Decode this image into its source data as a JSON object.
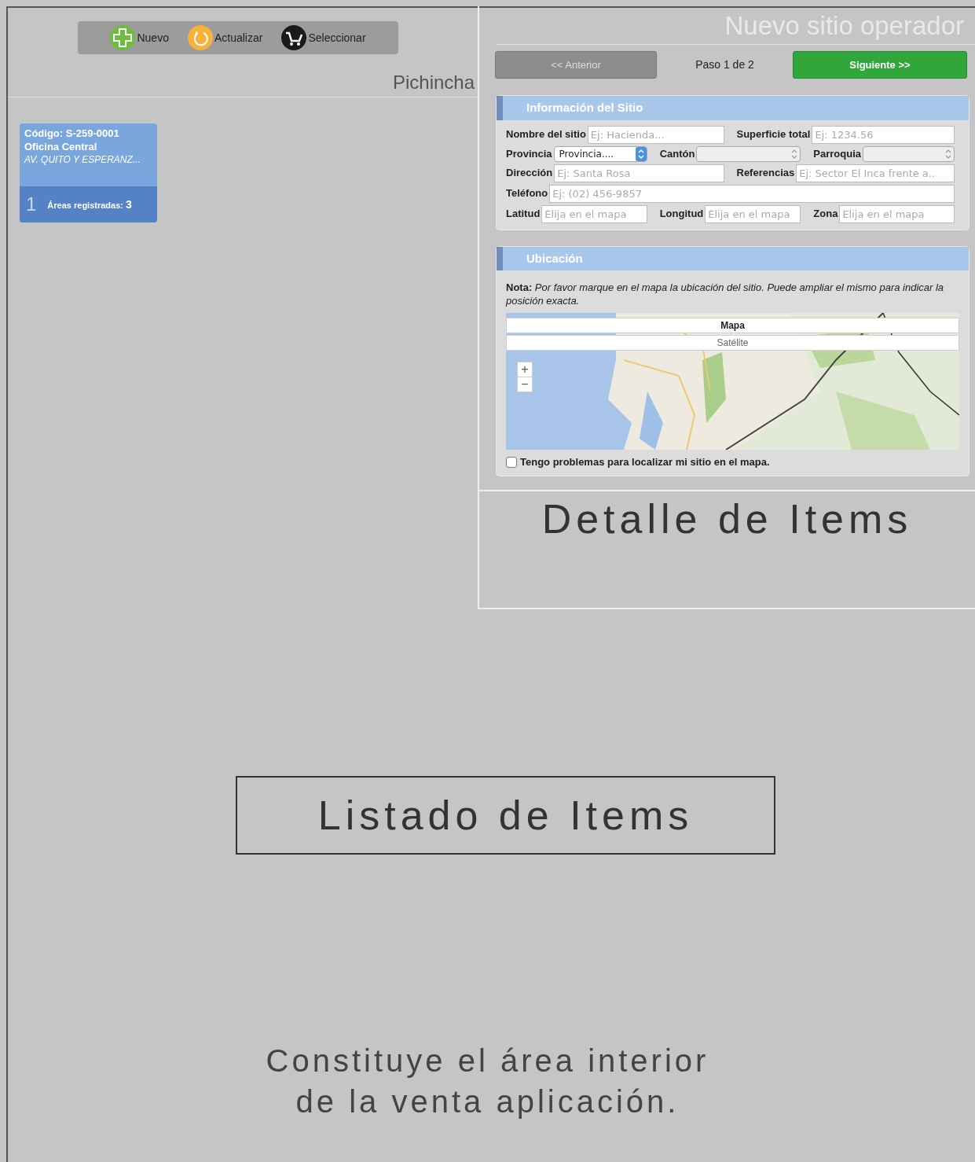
{
  "toolbar": {
    "buttons": [
      {
        "label": "Nuevo",
        "kind": "new"
      },
      {
        "label": "Actualizar",
        "kind": "refresh"
      },
      {
        "label": "Seleccionar",
        "kind": "select"
      }
    ]
  },
  "region_label": "Pichincha",
  "sites": [
    {
      "code": "Código: S-259-0001",
      "name": "Oficina Central",
      "address": "AV. QUITO Y ESPERANZ...",
      "number": "1",
      "areas_label": "Áreas registradas:",
      "areas_count": "3"
    }
  ],
  "detail_panel": {
    "title": "Nuevo sitio operador",
    "prev_button": {
      "label": "<< Anterior",
      "disabled": true
    },
    "step": "Paso 1 de 2",
    "next_button": {
      "label": "Siguiente >>",
      "disabled": false
    },
    "site_info": {
      "heading": "Información del Sitio",
      "rows": [
        [
          {
            "label": "Nombre del sitio",
            "kind": "input",
            "placeholder": "Ej: Hacienda..."
          },
          {
            "label": "Superficie total",
            "kind": "input",
            "placeholder": "Ej: 1234.56"
          }
        ],
        [
          {
            "label": "Provincia",
            "kind": "select",
            "value": "Provincia....",
            "disabled": false
          },
          {
            "label": "Cantón",
            "kind": "select",
            "disabled": true
          },
          {
            "label": "Parroquia",
            "kind": "select",
            "disabled": true
          }
        ],
        [
          {
            "label": "Dirección",
            "kind": "input",
            "placeholder": "Ej: Santa Rosa"
          },
          {
            "label": "Referencias",
            "kind": "input",
            "placeholder": "Ej: Sector El Inca frente a.."
          }
        ],
        [
          {
            "label": "Teléfono",
            "kind": "input",
            "placeholder": "Ej: (02) 456-9857"
          }
        ],
        [
          {
            "label": "Latitud",
            "kind": "input",
            "placeholder": "Elija en el mapa"
          },
          {
            "label": "Longitud",
            "kind": "input",
            "placeholder": "Elija en el mapa"
          },
          {
            "label": "Zona",
            "kind": "input",
            "placeholder": "Elija en el mapa"
          }
        ]
      ]
    },
    "location": {
      "heading": "Ubicación",
      "note": "**Nota:** *Por favor marque en el mapa la ubicación del sitio. Puede ampliar el mismo para indicar la posición exacta.*",
      "map": {
        "kind": "picture",
        "map_types": [
          {
            "label": "Mapa",
            "selected": true
          },
          {
            "label": "Satélite",
            "selected": false
          }
        ],
        "zoom_in": "+",
        "zoom_out": "−"
      },
      "checkbox": {
        "label": "Tengo problemas para localizar mi sitio en el mapa.",
        "checked": false
      }
    }
  },
  "detail_caption": "Detalle de Items",
  "list_caption": "Listado de Items",
  "description": [
    "Constituye el área interior",
    "de la venta aplicación."
  ]
}
